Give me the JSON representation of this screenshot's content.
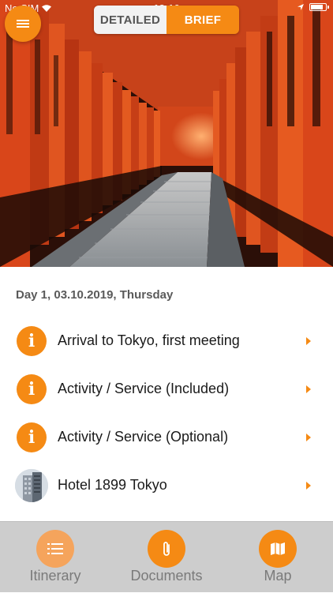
{
  "status_bar": {
    "carrier": "No SIM",
    "time": "13:16"
  },
  "header": {
    "menu_icon": "hamburger-menu-icon",
    "segments": [
      {
        "label": "DETAILED",
        "selected": false
      },
      {
        "label": "BRIEF",
        "selected": true
      }
    ]
  },
  "hero_image": {
    "description_icon": "torii-gates-photo"
  },
  "itinerary": {
    "day_header": "Day 1, 03.10.2019, Thursday",
    "items": [
      {
        "label": "Arrival to Tokyo, first meeting",
        "icon": "info-icon"
      },
      {
        "label": "Activity / Service (Included)",
        "icon": "info-icon"
      },
      {
        "label": "Activity / Service (Optional)",
        "icon": "info-icon"
      },
      {
        "label": "Hotel 1899 Tokyo",
        "icon": "hotel-photo-thumbnail"
      }
    ]
  },
  "tab_bar": {
    "tabs": [
      {
        "label": "Itinerary",
        "icon": "list-icon",
        "active": false
      },
      {
        "label": "Documents",
        "icon": "paperclip-icon",
        "active": true
      },
      {
        "label": "Map",
        "icon": "map-icon",
        "active": true
      }
    ]
  },
  "colors": {
    "accent": "#f58a14",
    "accent_inactive": "#f5a45c",
    "tabbar_bg": "#cdcdcd",
    "text_dark": "#1a1a1a",
    "text_muted": "#5a5a5a"
  }
}
